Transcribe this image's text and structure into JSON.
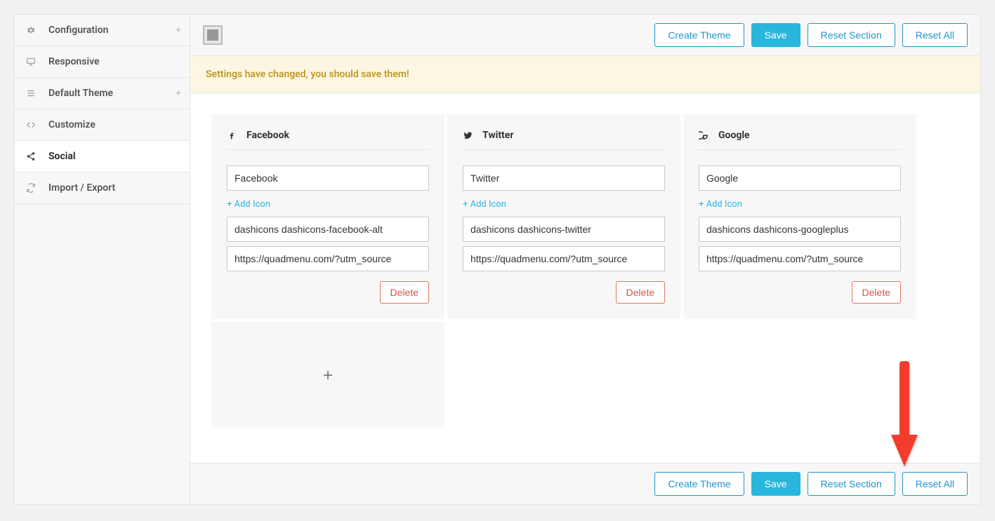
{
  "sidebar": {
    "items": [
      {
        "label": "Configuration",
        "icon": "gear",
        "expandable": true
      },
      {
        "label": "Responsive",
        "icon": "desktop",
        "expandable": false
      },
      {
        "label": "Default Theme",
        "icon": "menu",
        "expandable": true
      },
      {
        "label": "Customize",
        "icon": "code",
        "expandable": false
      },
      {
        "label": "Social",
        "icon": "share",
        "expandable": false
      },
      {
        "label": "Import / Export",
        "icon": "refresh",
        "expandable": false
      }
    ]
  },
  "toolbar": {
    "create_theme": "Create Theme",
    "save": "Save",
    "reset_section": "Reset Section",
    "reset_all": "Reset All"
  },
  "notice": "Settings have changed, you should save them!",
  "social": {
    "add_icon_label": "+ Add Icon",
    "delete_label": "Delete",
    "cards": [
      {
        "title": "Facebook",
        "name_value": "Facebook",
        "icon_value": "dashicons dashicons-facebook-alt",
        "url_value": "https://quadmenu.com/?utm_source"
      },
      {
        "title": "Twitter",
        "name_value": "Twitter",
        "icon_value": "dashicons dashicons-twitter",
        "url_value": "https://quadmenu.com/?utm_source"
      },
      {
        "title": "Google",
        "name_value": "Google",
        "icon_value": "dashicons dashicons-googleplus",
        "url_value": "https://quadmenu.com/?utm_source"
      }
    ]
  }
}
